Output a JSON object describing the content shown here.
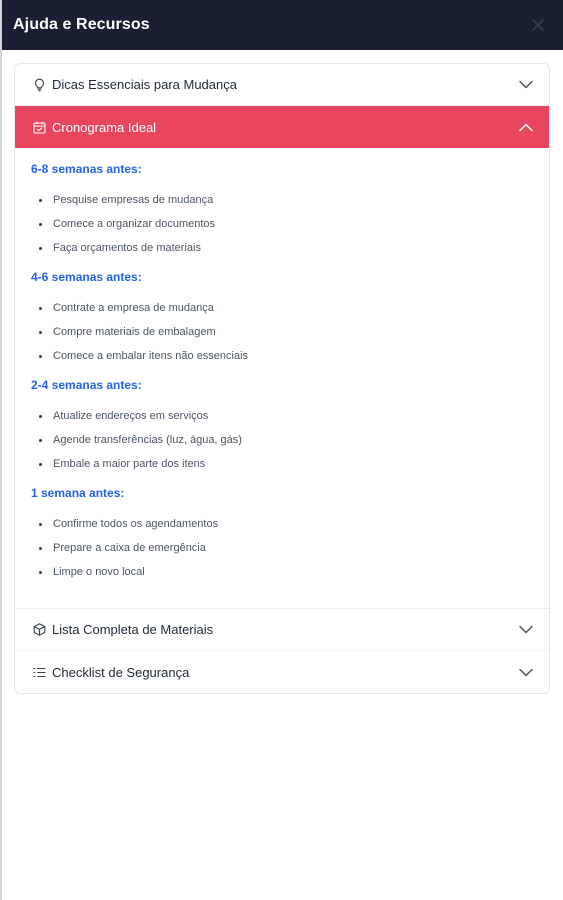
{
  "header": {
    "title": "Ajuda e Recursos",
    "close_icon": "close-icon"
  },
  "accordion": [
    {
      "label": "Dicas Essenciais para Mudança",
      "icon": "lightbulb-icon",
      "expanded": false
    },
    {
      "label": "Cronograma Ideal",
      "icon": "calendar-check-icon",
      "expanded": true
    },
    {
      "label": "Lista Completa de Materiais",
      "icon": "box-icon",
      "expanded": false
    },
    {
      "label": "Checklist de Segurança",
      "icon": "list-icon",
      "expanded": false
    }
  ],
  "timeline": [
    {
      "title": "6-8 semanas antes:",
      "items": [
        "Pesquise empresas de mudança",
        "Comece a organizar documentos",
        "Faça orçamentos de materiais"
      ]
    },
    {
      "title": "4-6 semanas antes:",
      "items": [
        "Contrate a empresa de mudança",
        "Compre materiais de embalagem",
        "Comece a embalar itens não essenciais"
      ]
    },
    {
      "title": "2-4 semanas antes:",
      "items": [
        "Atualize endereços em serviços",
        "Agende transferências (luz, água, gás)",
        "Embale a maior parte dos itens"
      ]
    },
    {
      "title": "1 semana antes:",
      "items": [
        "Confirme todos os agendamentos",
        "Prepare a caixa de emergência",
        "Limpe o novo local"
      ]
    }
  ],
  "colors": {
    "header_bg": "#1b1f33",
    "active_bg": "#e8455f",
    "phase_title": "#2563eb"
  }
}
